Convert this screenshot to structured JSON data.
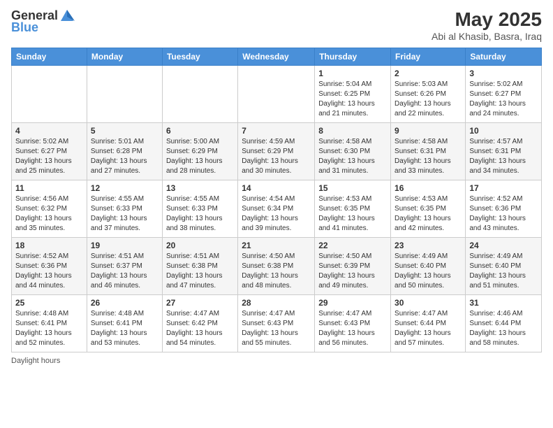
{
  "header": {
    "logo_general": "General",
    "logo_blue": "Blue",
    "title": "May 2025",
    "subtitle": "Abi al Khasib, Basra, Iraq"
  },
  "calendar": {
    "days": [
      "Sunday",
      "Monday",
      "Tuesday",
      "Wednesday",
      "Thursday",
      "Friday",
      "Saturday"
    ],
    "weeks": [
      [
        {
          "num": "",
          "info": ""
        },
        {
          "num": "",
          "info": ""
        },
        {
          "num": "",
          "info": ""
        },
        {
          "num": "",
          "info": ""
        },
        {
          "num": "1",
          "info": "Sunrise: 5:04 AM\nSunset: 6:25 PM\nDaylight: 13 hours\nand 21 minutes."
        },
        {
          "num": "2",
          "info": "Sunrise: 5:03 AM\nSunset: 6:26 PM\nDaylight: 13 hours\nand 22 minutes."
        },
        {
          "num": "3",
          "info": "Sunrise: 5:02 AM\nSunset: 6:27 PM\nDaylight: 13 hours\nand 24 minutes."
        }
      ],
      [
        {
          "num": "4",
          "info": "Sunrise: 5:02 AM\nSunset: 6:27 PM\nDaylight: 13 hours\nand 25 minutes."
        },
        {
          "num": "5",
          "info": "Sunrise: 5:01 AM\nSunset: 6:28 PM\nDaylight: 13 hours\nand 27 minutes."
        },
        {
          "num": "6",
          "info": "Sunrise: 5:00 AM\nSunset: 6:29 PM\nDaylight: 13 hours\nand 28 minutes."
        },
        {
          "num": "7",
          "info": "Sunrise: 4:59 AM\nSunset: 6:29 PM\nDaylight: 13 hours\nand 30 minutes."
        },
        {
          "num": "8",
          "info": "Sunrise: 4:58 AM\nSunset: 6:30 PM\nDaylight: 13 hours\nand 31 minutes."
        },
        {
          "num": "9",
          "info": "Sunrise: 4:58 AM\nSunset: 6:31 PM\nDaylight: 13 hours\nand 33 minutes."
        },
        {
          "num": "10",
          "info": "Sunrise: 4:57 AM\nSunset: 6:31 PM\nDaylight: 13 hours\nand 34 minutes."
        }
      ],
      [
        {
          "num": "11",
          "info": "Sunrise: 4:56 AM\nSunset: 6:32 PM\nDaylight: 13 hours\nand 35 minutes."
        },
        {
          "num": "12",
          "info": "Sunrise: 4:55 AM\nSunset: 6:33 PM\nDaylight: 13 hours\nand 37 minutes."
        },
        {
          "num": "13",
          "info": "Sunrise: 4:55 AM\nSunset: 6:33 PM\nDaylight: 13 hours\nand 38 minutes."
        },
        {
          "num": "14",
          "info": "Sunrise: 4:54 AM\nSunset: 6:34 PM\nDaylight: 13 hours\nand 39 minutes."
        },
        {
          "num": "15",
          "info": "Sunrise: 4:53 AM\nSunset: 6:35 PM\nDaylight: 13 hours\nand 41 minutes."
        },
        {
          "num": "16",
          "info": "Sunrise: 4:53 AM\nSunset: 6:35 PM\nDaylight: 13 hours\nand 42 minutes."
        },
        {
          "num": "17",
          "info": "Sunrise: 4:52 AM\nSunset: 6:36 PM\nDaylight: 13 hours\nand 43 minutes."
        }
      ],
      [
        {
          "num": "18",
          "info": "Sunrise: 4:52 AM\nSunset: 6:36 PM\nDaylight: 13 hours\nand 44 minutes."
        },
        {
          "num": "19",
          "info": "Sunrise: 4:51 AM\nSunset: 6:37 PM\nDaylight: 13 hours\nand 46 minutes."
        },
        {
          "num": "20",
          "info": "Sunrise: 4:51 AM\nSunset: 6:38 PM\nDaylight: 13 hours\nand 47 minutes."
        },
        {
          "num": "21",
          "info": "Sunrise: 4:50 AM\nSunset: 6:38 PM\nDaylight: 13 hours\nand 48 minutes."
        },
        {
          "num": "22",
          "info": "Sunrise: 4:50 AM\nSunset: 6:39 PM\nDaylight: 13 hours\nand 49 minutes."
        },
        {
          "num": "23",
          "info": "Sunrise: 4:49 AM\nSunset: 6:40 PM\nDaylight: 13 hours\nand 50 minutes."
        },
        {
          "num": "24",
          "info": "Sunrise: 4:49 AM\nSunset: 6:40 PM\nDaylight: 13 hours\nand 51 minutes."
        }
      ],
      [
        {
          "num": "25",
          "info": "Sunrise: 4:48 AM\nSunset: 6:41 PM\nDaylight: 13 hours\nand 52 minutes."
        },
        {
          "num": "26",
          "info": "Sunrise: 4:48 AM\nSunset: 6:41 PM\nDaylight: 13 hours\nand 53 minutes."
        },
        {
          "num": "27",
          "info": "Sunrise: 4:47 AM\nSunset: 6:42 PM\nDaylight: 13 hours\nand 54 minutes."
        },
        {
          "num": "28",
          "info": "Sunrise: 4:47 AM\nSunset: 6:43 PM\nDaylight: 13 hours\nand 55 minutes."
        },
        {
          "num": "29",
          "info": "Sunrise: 4:47 AM\nSunset: 6:43 PM\nDaylight: 13 hours\nand 56 minutes."
        },
        {
          "num": "30",
          "info": "Sunrise: 4:47 AM\nSunset: 6:44 PM\nDaylight: 13 hours\nand 57 minutes."
        },
        {
          "num": "31",
          "info": "Sunrise: 4:46 AM\nSunset: 6:44 PM\nDaylight: 13 hours\nand 58 minutes."
        }
      ]
    ]
  },
  "footer": {
    "note": "Daylight hours"
  }
}
